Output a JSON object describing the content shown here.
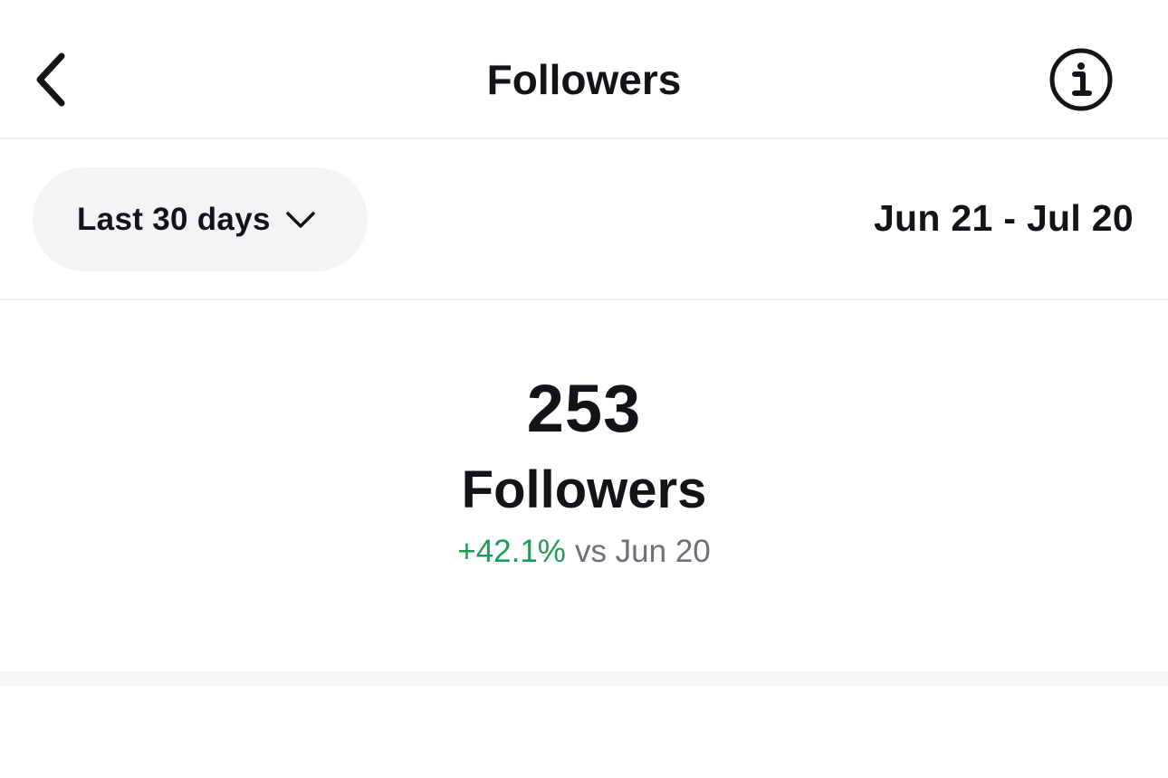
{
  "header": {
    "title": "Followers",
    "back_icon": "chevron-left-icon",
    "info_icon": "info-circle-icon"
  },
  "filter": {
    "range_label": "Last 30 days",
    "range_icon": "chevron-down-icon",
    "date_range": "Jun 21 - Jul 20"
  },
  "stats": {
    "value": "253",
    "label": "Followers",
    "change_percent": "+42.1%",
    "change_comparison": "vs Jun 20"
  },
  "colors": {
    "text": "#121417",
    "positive": "#1f9d55",
    "muted": "#6b7079",
    "pill_bg": "#f3f4f6"
  }
}
